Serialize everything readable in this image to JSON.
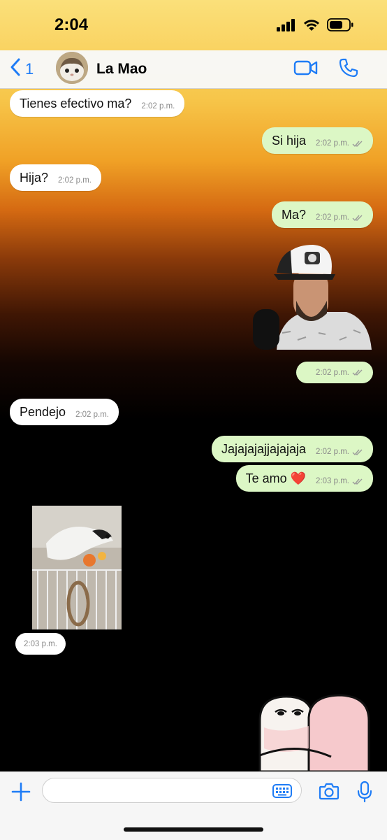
{
  "status_bar": {
    "time": "2:04"
  },
  "header": {
    "back_count": "1",
    "contact_name": "La Mao"
  },
  "messages": [
    {
      "dir": "in",
      "text": "Tienes efectivo ma?",
      "time": "2:02 p.m."
    },
    {
      "dir": "out",
      "text": "Si hija",
      "time": "2:02 p.m."
    },
    {
      "dir": "in",
      "text": "Hija?",
      "time": "2:02 p.m."
    },
    {
      "dir": "out",
      "text": "Ma?",
      "time": "2:02 p.m."
    },
    {
      "dir": "out",
      "text": "",
      "time": "2:02 p.m."
    },
    {
      "dir": "in",
      "text": "Pendejo",
      "time": "2:02 p.m."
    },
    {
      "dir": "out",
      "text": "Jajajajajjajajaja",
      "time": "2:02 p.m."
    },
    {
      "dir": "out",
      "text": "Te amo ❤️",
      "time": "2:03 p.m."
    },
    {
      "dir": "in",
      "text": "",
      "time": "2:03 p.m."
    }
  ],
  "colors": {
    "accent": "#1e7cf6",
    "incoming_bubble": "#ffffff",
    "outgoing_bubble": "#dcf7c5",
    "read_ticks": "#9a9a9a"
  },
  "icons": {
    "back": "chevron-left-icon",
    "video": "video-camera-icon",
    "phone": "phone-icon",
    "plus": "plus-icon",
    "keyboard": "keyboard-icon",
    "camera": "camera-icon",
    "mic": "microphone-icon"
  },
  "input": {
    "placeholder": ""
  }
}
